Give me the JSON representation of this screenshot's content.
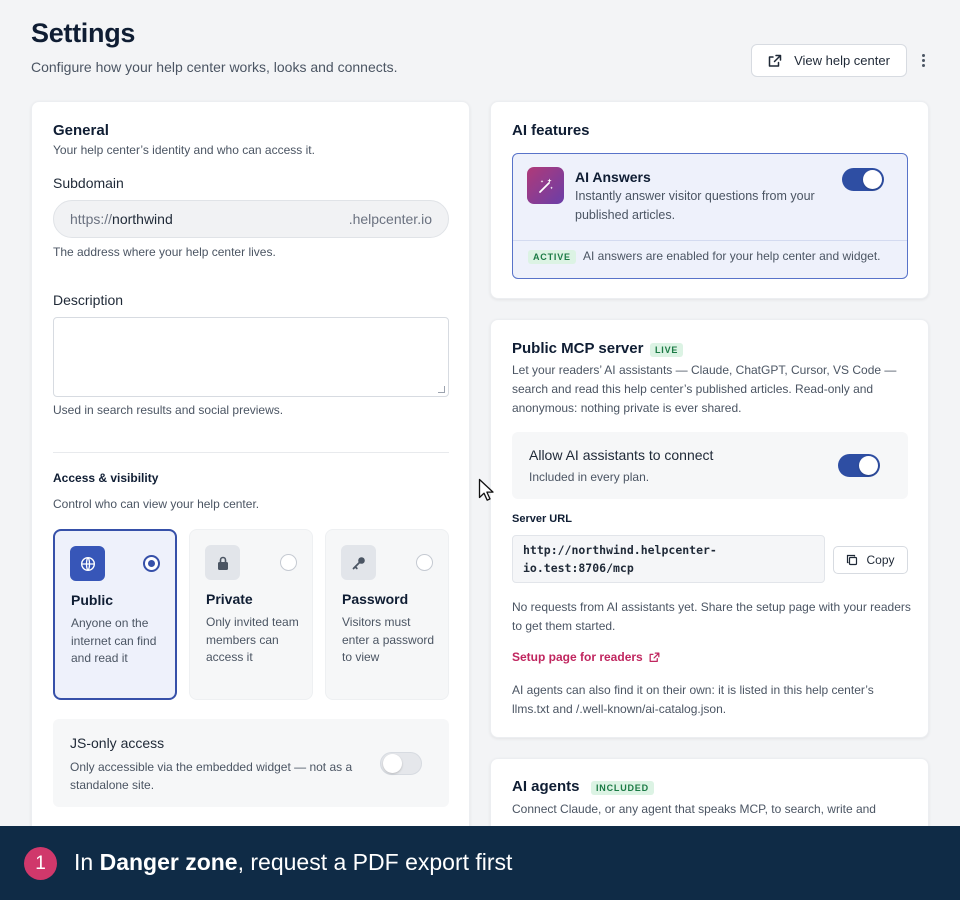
{
  "header": {
    "title": "Settings",
    "subtitle": "Configure how your help center works, looks and connects.",
    "view_button": "View help center"
  },
  "general": {
    "title": "General",
    "subtitle": "Your help center’s identity and who can access it.",
    "subdomain_label": "Subdomain",
    "subdomain_prefix": "https://",
    "subdomain_value": "northwind",
    "subdomain_suffix": ".helpcenter.io",
    "subdomain_help": "The address where your help center lives.",
    "description_label": "Description",
    "description_value": "",
    "description_help": "Used in search results and social previews."
  },
  "access": {
    "title": "Access & visibility",
    "subtitle": "Control who can view your help center.",
    "selected": "Public",
    "options": [
      {
        "title": "Public",
        "desc": "Anyone on the internet can find and read it",
        "icon": "globe-icon"
      },
      {
        "title": "Private",
        "desc": "Only invited team members can access it",
        "icon": "lock-icon"
      },
      {
        "title": "Password",
        "desc": "Visitors must enter a password to view",
        "icon": "key-icon"
      }
    ],
    "js_only_title": "JS-only access",
    "js_only_desc": "Only accessible via the embedded widget — not as a standalone site.",
    "js_only_enabled": false
  },
  "ai_features": {
    "title": "AI features",
    "answers_title": "AI Answers",
    "answers_desc": "Instantly answer visitor questions from your published articles.",
    "answers_enabled": true,
    "status_badge": "ACTIVE",
    "status_text": "AI answers are enabled for your help center and widget."
  },
  "mcp": {
    "title": "Public MCP server",
    "badge": "LIVE",
    "desc": "Let your readers’ AI assistants — Claude, ChatGPT, Cursor, VS Code — search and read this help center’s published articles. Read-only and anonymous: nothing private is ever shared.",
    "allow_title": "Allow AI assistants to connect",
    "allow_sub": "Included in every plan.",
    "allow_enabled": true,
    "url_label": "Server URL",
    "url_line1": "http://northwind.helpcenter-",
    "url_line2": "io.test:8706/mcp",
    "copy_label": "Copy",
    "no_requests": "No requests from AI assistants yet. Share the setup page with your readers to get them started.",
    "setup_link": "Setup page for readers",
    "discover_text": "AI agents can also find it on their own: it is listed in this help center’s llms.txt and /.well-known/ai-catalog.json."
  },
  "agents": {
    "title": "AI agents",
    "badge": "INCLUDED",
    "desc": "Connect Claude, or any agent that speaks MCP, to search, write and"
  },
  "banner": {
    "step": "1",
    "prefix": "In ",
    "bold": "Danger zone",
    "suffix": ", request a PDF export first"
  },
  "colors": {
    "accent": "#2e4ea3",
    "link": "#c0265f",
    "banner_bg": "#0f2b46",
    "step_bg": "#d0386b",
    "badge_green_bg": "#dcf3e4",
    "badge_green_fg": "#1b7a45"
  }
}
